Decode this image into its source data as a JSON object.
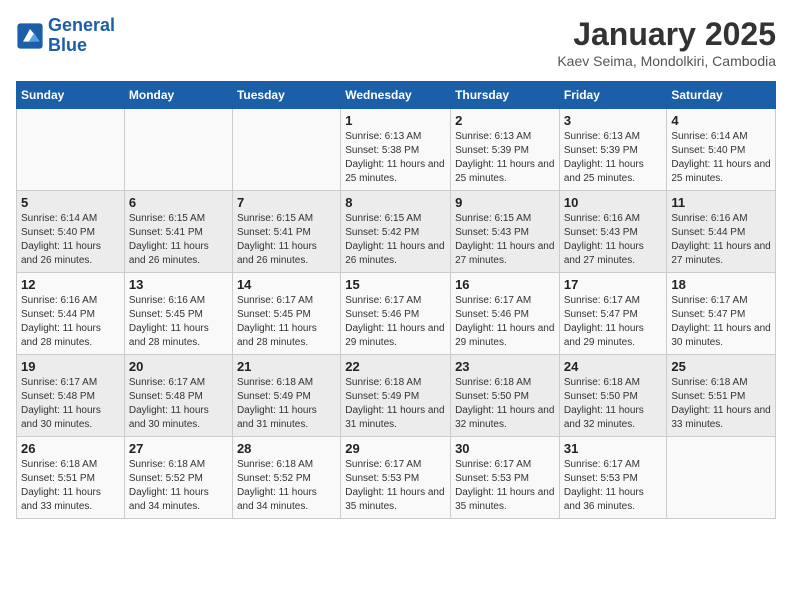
{
  "header": {
    "logo_line1": "General",
    "logo_line2": "Blue",
    "title": "January 2025",
    "subtitle": "Kaev Seima, Mondolkiri, Cambodia"
  },
  "days_of_week": [
    "Sunday",
    "Monday",
    "Tuesday",
    "Wednesday",
    "Thursday",
    "Friday",
    "Saturday"
  ],
  "weeks": [
    [
      {
        "day": "",
        "sunrise": "",
        "sunset": "",
        "daylight": ""
      },
      {
        "day": "",
        "sunrise": "",
        "sunset": "",
        "daylight": ""
      },
      {
        "day": "",
        "sunrise": "",
        "sunset": "",
        "daylight": ""
      },
      {
        "day": "1",
        "sunrise": "Sunrise: 6:13 AM",
        "sunset": "Sunset: 5:38 PM",
        "daylight": "Daylight: 11 hours and 25 minutes."
      },
      {
        "day": "2",
        "sunrise": "Sunrise: 6:13 AM",
        "sunset": "Sunset: 5:39 PM",
        "daylight": "Daylight: 11 hours and 25 minutes."
      },
      {
        "day": "3",
        "sunrise": "Sunrise: 6:13 AM",
        "sunset": "Sunset: 5:39 PM",
        "daylight": "Daylight: 11 hours and 25 minutes."
      },
      {
        "day": "4",
        "sunrise": "Sunrise: 6:14 AM",
        "sunset": "Sunset: 5:40 PM",
        "daylight": "Daylight: 11 hours and 25 minutes."
      }
    ],
    [
      {
        "day": "5",
        "sunrise": "Sunrise: 6:14 AM",
        "sunset": "Sunset: 5:40 PM",
        "daylight": "Daylight: 11 hours and 26 minutes."
      },
      {
        "day": "6",
        "sunrise": "Sunrise: 6:15 AM",
        "sunset": "Sunset: 5:41 PM",
        "daylight": "Daylight: 11 hours and 26 minutes."
      },
      {
        "day": "7",
        "sunrise": "Sunrise: 6:15 AM",
        "sunset": "Sunset: 5:41 PM",
        "daylight": "Daylight: 11 hours and 26 minutes."
      },
      {
        "day": "8",
        "sunrise": "Sunrise: 6:15 AM",
        "sunset": "Sunset: 5:42 PM",
        "daylight": "Daylight: 11 hours and 26 minutes."
      },
      {
        "day": "9",
        "sunrise": "Sunrise: 6:15 AM",
        "sunset": "Sunset: 5:43 PM",
        "daylight": "Daylight: 11 hours and 27 minutes."
      },
      {
        "day": "10",
        "sunrise": "Sunrise: 6:16 AM",
        "sunset": "Sunset: 5:43 PM",
        "daylight": "Daylight: 11 hours and 27 minutes."
      },
      {
        "day": "11",
        "sunrise": "Sunrise: 6:16 AM",
        "sunset": "Sunset: 5:44 PM",
        "daylight": "Daylight: 11 hours and 27 minutes."
      }
    ],
    [
      {
        "day": "12",
        "sunrise": "Sunrise: 6:16 AM",
        "sunset": "Sunset: 5:44 PM",
        "daylight": "Daylight: 11 hours and 28 minutes."
      },
      {
        "day": "13",
        "sunrise": "Sunrise: 6:16 AM",
        "sunset": "Sunset: 5:45 PM",
        "daylight": "Daylight: 11 hours and 28 minutes."
      },
      {
        "day": "14",
        "sunrise": "Sunrise: 6:17 AM",
        "sunset": "Sunset: 5:45 PM",
        "daylight": "Daylight: 11 hours and 28 minutes."
      },
      {
        "day": "15",
        "sunrise": "Sunrise: 6:17 AM",
        "sunset": "Sunset: 5:46 PM",
        "daylight": "Daylight: 11 hours and 29 minutes."
      },
      {
        "day": "16",
        "sunrise": "Sunrise: 6:17 AM",
        "sunset": "Sunset: 5:46 PM",
        "daylight": "Daylight: 11 hours and 29 minutes."
      },
      {
        "day": "17",
        "sunrise": "Sunrise: 6:17 AM",
        "sunset": "Sunset: 5:47 PM",
        "daylight": "Daylight: 11 hours and 29 minutes."
      },
      {
        "day": "18",
        "sunrise": "Sunrise: 6:17 AM",
        "sunset": "Sunset: 5:47 PM",
        "daylight": "Daylight: 11 hours and 30 minutes."
      }
    ],
    [
      {
        "day": "19",
        "sunrise": "Sunrise: 6:17 AM",
        "sunset": "Sunset: 5:48 PM",
        "daylight": "Daylight: 11 hours and 30 minutes."
      },
      {
        "day": "20",
        "sunrise": "Sunrise: 6:17 AM",
        "sunset": "Sunset: 5:48 PM",
        "daylight": "Daylight: 11 hours and 30 minutes."
      },
      {
        "day": "21",
        "sunrise": "Sunrise: 6:18 AM",
        "sunset": "Sunset: 5:49 PM",
        "daylight": "Daylight: 11 hours and 31 minutes."
      },
      {
        "day": "22",
        "sunrise": "Sunrise: 6:18 AM",
        "sunset": "Sunset: 5:49 PM",
        "daylight": "Daylight: 11 hours and 31 minutes."
      },
      {
        "day": "23",
        "sunrise": "Sunrise: 6:18 AM",
        "sunset": "Sunset: 5:50 PM",
        "daylight": "Daylight: 11 hours and 32 minutes."
      },
      {
        "day": "24",
        "sunrise": "Sunrise: 6:18 AM",
        "sunset": "Sunset: 5:50 PM",
        "daylight": "Daylight: 11 hours and 32 minutes."
      },
      {
        "day": "25",
        "sunrise": "Sunrise: 6:18 AM",
        "sunset": "Sunset: 5:51 PM",
        "daylight": "Daylight: 11 hours and 33 minutes."
      }
    ],
    [
      {
        "day": "26",
        "sunrise": "Sunrise: 6:18 AM",
        "sunset": "Sunset: 5:51 PM",
        "daylight": "Daylight: 11 hours and 33 minutes."
      },
      {
        "day": "27",
        "sunrise": "Sunrise: 6:18 AM",
        "sunset": "Sunset: 5:52 PM",
        "daylight": "Daylight: 11 hours and 34 minutes."
      },
      {
        "day": "28",
        "sunrise": "Sunrise: 6:18 AM",
        "sunset": "Sunset: 5:52 PM",
        "daylight": "Daylight: 11 hours and 34 minutes."
      },
      {
        "day": "29",
        "sunrise": "Sunrise: 6:17 AM",
        "sunset": "Sunset: 5:53 PM",
        "daylight": "Daylight: 11 hours and 35 minutes."
      },
      {
        "day": "30",
        "sunrise": "Sunrise: 6:17 AM",
        "sunset": "Sunset: 5:53 PM",
        "daylight": "Daylight: 11 hours and 35 minutes."
      },
      {
        "day": "31",
        "sunrise": "Sunrise: 6:17 AM",
        "sunset": "Sunset: 5:53 PM",
        "daylight": "Daylight: 11 hours and 36 minutes."
      },
      {
        "day": "",
        "sunrise": "",
        "sunset": "",
        "daylight": ""
      }
    ]
  ]
}
